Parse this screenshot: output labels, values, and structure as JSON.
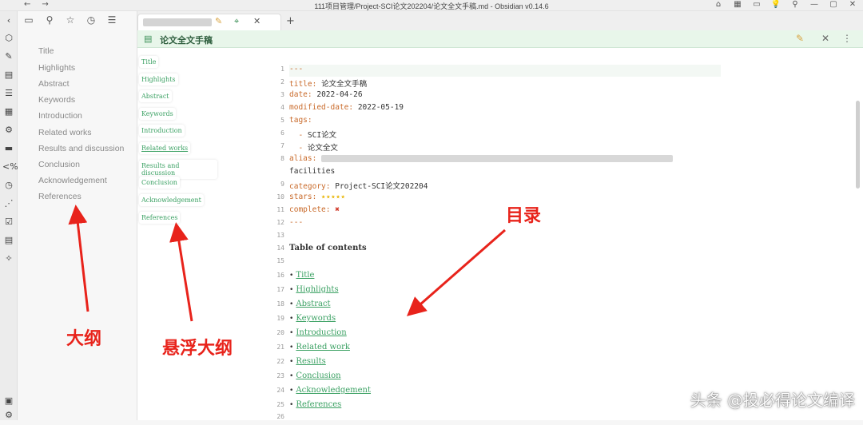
{
  "window": {
    "title": "111项目管理/Project-SCI论文202204/论文全文手稿.md - Obsidian v0.14.6",
    "nav_back": "←",
    "nav_forward": "→",
    "controls": [
      "⌂",
      "▦",
      "▭",
      "💡",
      "⚲",
      "—",
      "▢",
      "✕"
    ]
  },
  "ribbon": {
    "icons": [
      "‹",
      "⬡",
      "✎",
      "▤",
      "☰",
      "▦",
      "⚙",
      "▬",
      "<%",
      "◷",
      "⋰",
      "☑",
      "▤",
      "✧"
    ],
    "bottom_icons": [
      "▣",
      "⚙"
    ]
  },
  "sidebar": {
    "tools": [
      "▭",
      "⚲",
      "☆",
      "◷",
      "☰"
    ],
    "outline": [
      "Title",
      "Highlights",
      "Abstract",
      "Keywords",
      "Introduction",
      "Related works",
      "Results and discussion",
      "Conclusion",
      "Acknowledgement",
      "References"
    ]
  },
  "tab": {
    "actions": [
      "✎",
      "⌖",
      "✕"
    ],
    "add": "+"
  },
  "view": {
    "title": "论文全文手稿",
    "actions": [
      "✎",
      "✕",
      "⋮"
    ]
  },
  "hover_outline": [
    "Title",
    "Highlights",
    "Abstract",
    "Keywords",
    "Introduction",
    "Related works",
    "Results and discussion",
    "Conclusion",
    "Acknowledgement",
    "References"
  ],
  "editor": {
    "line_numbers": [
      "1",
      "2",
      "3",
      "4",
      "5",
      "6",
      "7",
      "8",
      "9",
      "10",
      "11",
      "12",
      "13",
      "14",
      "15",
      "16",
      "17",
      "18",
      "19",
      "20",
      "21",
      "22",
      "23",
      "24",
      "25",
      "26"
    ],
    "frontmatter_open": "---",
    "title_key": "title:",
    "title_value": "论文全文手稿",
    "date_key": "date:",
    "date_value": "2022-04-26",
    "modified_key": "modified-date:",
    "modified_value": "2022-05-19",
    "tags_key": "tags:",
    "tag1": "SCI论文",
    "tag2": "论文全文",
    "alias_key": "alias:",
    "alias_cont": "facilities",
    "category_key": "category:",
    "category_value": "Project-SCI论文202204",
    "stars_key": "stars:",
    "stars_value": "⭑⭑⭑⭑⭑",
    "complete_key": "complete:",
    "complete_value": "✖",
    "frontmatter_close": "---",
    "toc_heading": "Table of contents",
    "toc": [
      "Title",
      "Highlights",
      "Abstract",
      "Keywords",
      "Introduction",
      "Related work",
      "Results",
      "Conclusion",
      "Acknowledgement",
      "References"
    ]
  },
  "annotations": {
    "outline": "大纲",
    "hover_outline": "悬浮大纲",
    "toc": "目录",
    "color": "#e8231b"
  },
  "watermark": "头条 @投必得论文编译"
}
